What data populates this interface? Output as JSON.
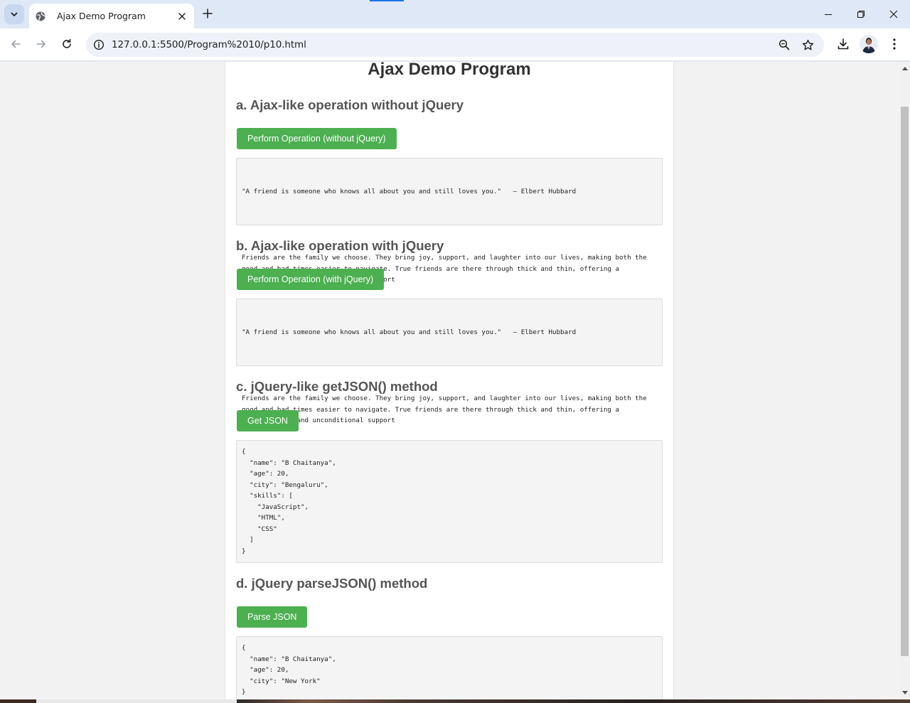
{
  "browser": {
    "tab_title": "Ajax Demo Program",
    "url": "127.0.0.1:5500/Program%2010/p10.html",
    "accent_color": "#1a73e8"
  },
  "page": {
    "title": "Ajax Demo Program",
    "button_color": "#4caf50",
    "sections": {
      "a": {
        "heading": "a. Ajax-like operation without jQuery",
        "button_label": "Perform Operation (without jQuery)",
        "output_quote": "\"A friend is someone who knows all about you and still loves you.\"   — Elbert Hubbard",
        "output_body": "Friends are the family we choose. They bring joy, support, and laughter into our lives, making both the good and bad times easier to navigate. True friends are there through thick and thin, offering a listening ear and unconditional support"
      },
      "b": {
        "heading": "b. Ajax-like operation with jQuery",
        "button_label": "Perform Operation (with jQuery)",
        "output_quote": "\"A friend is someone who knows all about you and still loves you.\"   — Elbert Hubbard",
        "output_body": "Friends are the family we choose. They bring joy, support, and laughter into our lives, making both the good and bad times easier to navigate. True friends are there through thick and thin, offering a listening ear and unconditional support"
      },
      "c": {
        "heading": "c. jQuery-like getJSON() method",
        "button_label": "Get JSON",
        "output": "{\n  \"name\": \"B Chaitanya\",\n  \"age\": 20,\n  \"city\": \"Bengaluru\",\n  \"skills\": [\n    \"JavaScript\",\n    \"HTML\",\n    \"CSS\"\n  ]\n}"
      },
      "d": {
        "heading": "d. jQuery parseJSON() method",
        "button_label": "Parse JSON",
        "output": "{\n  \"name\": \"B Chaitanya\",\n  \"age\": 20,\n  \"city\": \"New York\"\n}"
      }
    }
  }
}
